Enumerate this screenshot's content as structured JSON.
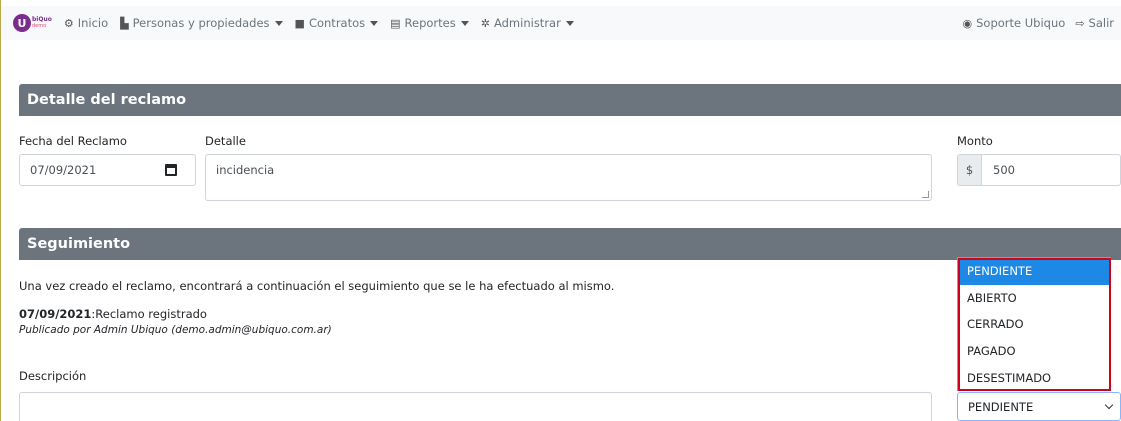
{
  "navbar": {
    "logo": {
      "mark": "U",
      "text_top": "biQuo",
      "text_bottom": "demo"
    },
    "items": [
      {
        "label": "Inicio",
        "icon": "dashboard-icon",
        "glyph": "⚙",
        "dropdown": false
      },
      {
        "label": "Personas y propiedades",
        "icon": "address-book-icon",
        "glyph": "▙",
        "dropdown": true
      },
      {
        "label": "Contratos",
        "icon": "contract-icon",
        "glyph": "■",
        "dropdown": true
      },
      {
        "label": "Reportes",
        "icon": "report-icon",
        "glyph": "▤",
        "dropdown": true
      },
      {
        "label": "Administrar",
        "icon": "gear-icon",
        "glyph": "✲",
        "dropdown": true
      }
    ],
    "right": [
      {
        "label": "Soporte Ubiquo",
        "icon": "user-circle-icon",
        "glyph": "◉"
      },
      {
        "label": "Salir",
        "icon": "sign-out-icon",
        "glyph": "⇨"
      }
    ]
  },
  "detail_section": {
    "title": "Detalle del reclamo",
    "date_label": "Fecha del Reclamo",
    "date_value": "07/09/2021",
    "detail_label": "Detalle",
    "detail_value": "incidencia",
    "amount_label": "Monto",
    "currency_symbol": "$",
    "amount_value": "500"
  },
  "followup_section": {
    "title": "Seguimiento",
    "info": "Una vez creado el reclamo, encontrará a continuación el seguimiento que se le ha efectuado al mismo.",
    "entry_date": "07/09/2021",
    "entry_text": ":Reclamo registrado",
    "entry_meta": "Publicado por Admin Ubiquo (demo.admin@ubiquo.com.ar)",
    "description_label": "Descripción",
    "status_selected": "PENDIENTE",
    "status_options": [
      "PENDIENTE",
      "ABIERTO",
      "CERRADO",
      "PAGADO",
      "DESESTIMADO"
    ]
  },
  "colors": {
    "header_bg": "#6c757d",
    "selected_option": "#1e88e5",
    "highlight": "#d0021b",
    "brand": "#7b2d8e"
  }
}
